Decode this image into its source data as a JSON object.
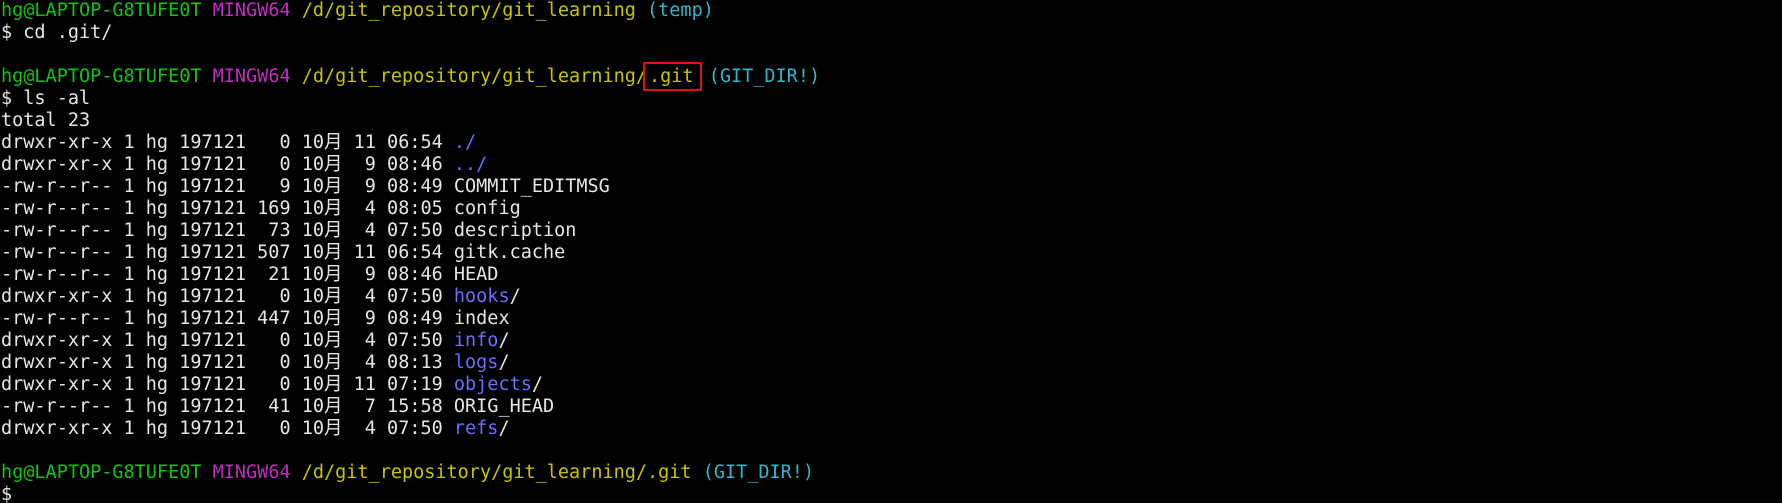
{
  "colors": {
    "background": "#000000",
    "text": "#e6e6e6",
    "user_host": "#12c312",
    "system": "#c02cc0",
    "path": "#c7c400",
    "branch": "#2fb7c9",
    "directory": "#6c6cff",
    "highlight_box": "#e01010"
  },
  "prompts": [
    {
      "user_host": "hg@LAPTOP-G8TUFE0T",
      "system": "MINGW64",
      "path": "/d/git_repository/git_learning",
      "branch": "(temp)",
      "command": "$ cd .git/"
    },
    {
      "user_host": "hg@LAPTOP-G8TUFE0T",
      "system": "MINGW64",
      "path_prefix": "/d/git_repository/git_learning/",
      "path_highlight": ".git",
      "branch": "(GIT_DIR!)",
      "command": "$ ls -al"
    },
    {
      "user_host": "hg@LAPTOP-G8TUFE0T",
      "system": "MINGW64",
      "path": "/d/git_repository/git_learning/.git",
      "branch": "(GIT_DIR!)",
      "command": "$"
    }
  ],
  "listing": {
    "total": "total 23",
    "entries": [
      {
        "meta": "drwxr-xr-x 1 hg 197121   0 10月 11 06:54 ",
        "name": "./",
        "suffix": "",
        "is_dir": true
      },
      {
        "meta": "drwxr-xr-x 1 hg 197121   0 10月  9 08:46 ",
        "name": "../",
        "suffix": "",
        "is_dir": true
      },
      {
        "meta": "-rw-r--r-- 1 hg 197121   9 10月  9 08:49 ",
        "name": "COMMIT_EDITMSG",
        "suffix": "",
        "is_dir": false
      },
      {
        "meta": "-rw-r--r-- 1 hg 197121 169 10月  4 08:05 ",
        "name": "config",
        "suffix": "",
        "is_dir": false
      },
      {
        "meta": "-rw-r--r-- 1 hg 197121  73 10月  4 07:50 ",
        "name": "description",
        "suffix": "",
        "is_dir": false
      },
      {
        "meta": "-rw-r--r-- 1 hg 197121 507 10月 11 06:54 ",
        "name": "gitk.cache",
        "suffix": "",
        "is_dir": false
      },
      {
        "meta": "-rw-r--r-- 1 hg 197121  21 10月  9 08:46 ",
        "name": "HEAD",
        "suffix": "",
        "is_dir": false
      },
      {
        "meta": "drwxr-xr-x 1 hg 197121   0 10月  4 07:50 ",
        "name": "hooks",
        "suffix": "/",
        "is_dir": true
      },
      {
        "meta": "-rw-r--r-- 1 hg 197121 447 10月  9 08:49 ",
        "name": "index",
        "suffix": "",
        "is_dir": false
      },
      {
        "meta": "drwxr-xr-x 1 hg 197121   0 10月  4 07:50 ",
        "name": "info",
        "suffix": "/",
        "is_dir": true
      },
      {
        "meta": "drwxr-xr-x 1 hg 197121   0 10月  4 08:13 ",
        "name": "logs",
        "suffix": "/",
        "is_dir": true
      },
      {
        "meta": "drwxr-xr-x 1 hg 197121   0 10月 11 07:19 ",
        "name": "objects",
        "suffix": "/",
        "is_dir": true
      },
      {
        "meta": "-rw-r--r-- 1 hg 197121  41 10月  7 15:58 ",
        "name": "ORIG_HEAD",
        "suffix": "",
        "is_dir": false
      },
      {
        "meta": "drwxr-xr-x 1 hg 197121   0 10月  4 07:50 ",
        "name": "refs",
        "suffix": "/",
        "is_dir": true
      }
    ]
  }
}
